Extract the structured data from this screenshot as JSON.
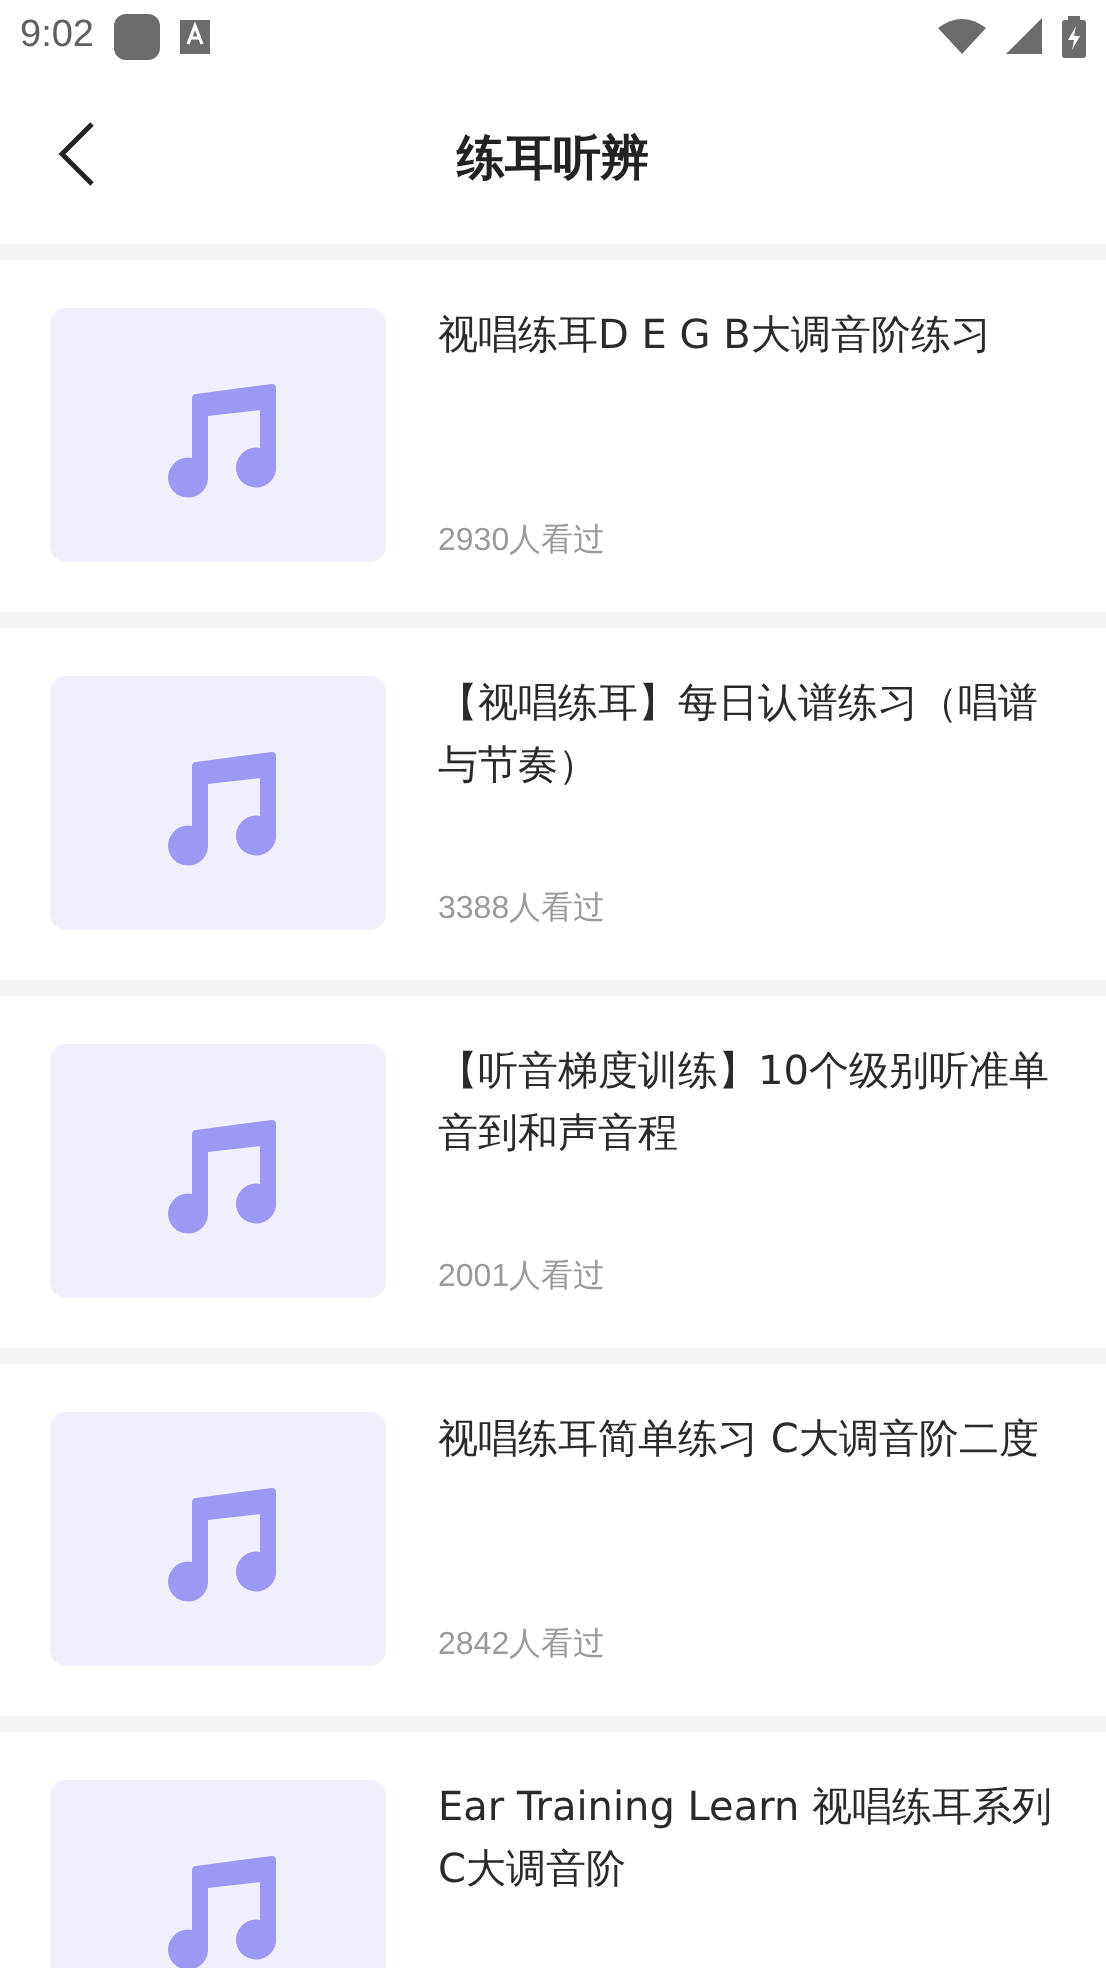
{
  "status_bar": {
    "time": "9:02"
  },
  "header": {
    "title": "练耳听辨"
  },
  "items": [
    {
      "title": "视唱练耳D E G B大调音阶练习",
      "views": "2930人看过"
    },
    {
      "title": "【视唱练耳】每日认谱练习（唱谱与节奏）",
      "views": "3388人看过"
    },
    {
      "title": "【听音梯度训练】10个级别听准单音到和声音程",
      "views": "2001人看过"
    },
    {
      "title": "视唱练耳简单练习 C大调音阶二度",
      "views": "2842人看过"
    },
    {
      "title": "Ear Training Learn 视唱练耳系列C大调音阶"
    }
  ]
}
